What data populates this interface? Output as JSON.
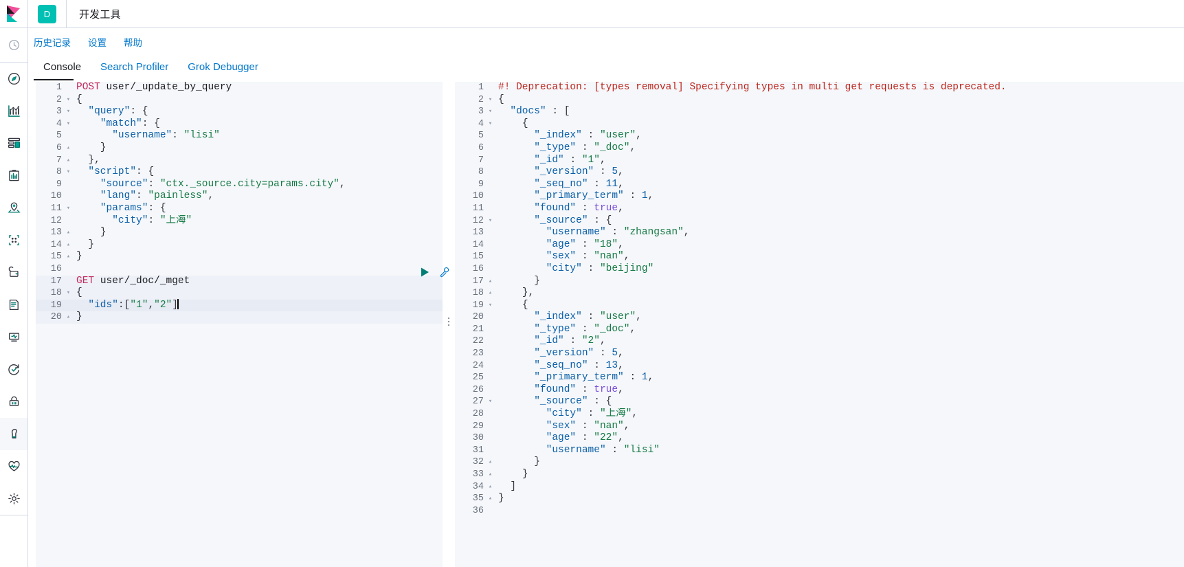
{
  "header": {
    "logo_letter": "D",
    "app_title": "开发工具"
  },
  "rail": {
    "items": [
      {
        "name": "recently-viewed-icon",
        "label": "最近查看"
      },
      {
        "name": "discover-icon",
        "label": "Discover"
      },
      {
        "name": "visualize-icon",
        "label": "Visualize"
      },
      {
        "name": "dashboard-icon",
        "label": "Dashboard"
      },
      {
        "name": "canvas-icon",
        "label": "Canvas"
      },
      {
        "name": "maps-icon",
        "label": "Maps"
      },
      {
        "name": "machine-learning-icon",
        "label": "Machine Learning"
      },
      {
        "name": "infrastructure-icon",
        "label": "Infrastructure"
      },
      {
        "name": "logs-icon",
        "label": "Logs"
      },
      {
        "name": "apm-icon",
        "label": "APM"
      },
      {
        "name": "uptime-icon",
        "label": "Uptime"
      },
      {
        "name": "security-icon",
        "label": "SIEM"
      },
      {
        "name": "dev-tools-icon",
        "label": "开发工具"
      },
      {
        "name": "monitoring-icon",
        "label": "Monitoring"
      },
      {
        "name": "management-icon",
        "label": "Management"
      }
    ],
    "selected_index": 12
  },
  "subnav": {
    "links": [
      {
        "name": "history-link",
        "label": "历史记录"
      },
      {
        "name": "settings-link",
        "label": "设置"
      },
      {
        "name": "help-link",
        "label": "帮助"
      }
    ]
  },
  "tabs": {
    "items": [
      {
        "name": "tab-console",
        "label": "Console",
        "active": true
      },
      {
        "name": "tab-search-profiler",
        "label": "Search Profiler",
        "active": false
      },
      {
        "name": "tab-grok-debugger",
        "label": "Grok Debugger",
        "active": false
      }
    ]
  },
  "request_editor": {
    "title": "request-editor",
    "cursor_line": 19,
    "lines": [
      {
        "n": 1,
        "fold": "",
        "text": "POST user/_update_by_query"
      },
      {
        "n": 2,
        "fold": "▾",
        "text": "{"
      },
      {
        "n": 3,
        "fold": "▾",
        "text": "  \"query\": {"
      },
      {
        "n": 4,
        "fold": "▾",
        "text": "    \"match\": {"
      },
      {
        "n": 5,
        "fold": "",
        "text": "      \"username\": \"lisi\""
      },
      {
        "n": 6,
        "fold": "▴",
        "text": "    }"
      },
      {
        "n": 7,
        "fold": "▴",
        "text": "  },"
      },
      {
        "n": 8,
        "fold": "▾",
        "text": "  \"script\": {"
      },
      {
        "n": 9,
        "fold": "",
        "text": "    \"source\": \"ctx._source.city=params.city\","
      },
      {
        "n": 10,
        "fold": "",
        "text": "    \"lang\": \"painless\","
      },
      {
        "n": 11,
        "fold": "▾",
        "text": "    \"params\": {"
      },
      {
        "n": 12,
        "fold": "",
        "text": "      \"city\": \"上海\""
      },
      {
        "n": 13,
        "fold": "▴",
        "text": "    }"
      },
      {
        "n": 14,
        "fold": "▴",
        "text": "  }"
      },
      {
        "n": 15,
        "fold": "▴",
        "text": "}"
      },
      {
        "n": 16,
        "fold": "",
        "text": ""
      },
      {
        "n": 17,
        "fold": "",
        "text": "GET user/_doc/_mget"
      },
      {
        "n": 18,
        "fold": "▾",
        "text": "{"
      },
      {
        "n": 19,
        "fold": "",
        "text": "  \"ids\":[\"1\",\"2\"]"
      },
      {
        "n": 20,
        "fold": "▴",
        "text": "}"
      }
    ]
  },
  "response_editor": {
    "title": "response-editor",
    "lines": [
      {
        "n": 1,
        "fold": "",
        "text": "#! Deprecation: [types removal] Specifying types in multi get requests is deprecated."
      },
      {
        "n": 2,
        "fold": "▾",
        "text": "{"
      },
      {
        "n": 3,
        "fold": "▾",
        "text": "  \"docs\" : ["
      },
      {
        "n": 4,
        "fold": "▾",
        "text": "    {"
      },
      {
        "n": 5,
        "fold": "",
        "text": "      \"_index\" : \"user\","
      },
      {
        "n": 6,
        "fold": "",
        "text": "      \"_type\" : \"_doc\","
      },
      {
        "n": 7,
        "fold": "",
        "text": "      \"_id\" : \"1\","
      },
      {
        "n": 8,
        "fold": "",
        "text": "      \"_version\" : 5,"
      },
      {
        "n": 9,
        "fold": "",
        "text": "      \"_seq_no\" : 11,"
      },
      {
        "n": 10,
        "fold": "",
        "text": "      \"_primary_term\" : 1,"
      },
      {
        "n": 11,
        "fold": "",
        "text": "      \"found\" : true,"
      },
      {
        "n": 12,
        "fold": "▾",
        "text": "      \"_source\" : {"
      },
      {
        "n": 13,
        "fold": "",
        "text": "        \"username\" : \"zhangsan\","
      },
      {
        "n": 14,
        "fold": "",
        "text": "        \"age\" : \"18\","
      },
      {
        "n": 15,
        "fold": "",
        "text": "        \"sex\" : \"nan\","
      },
      {
        "n": 16,
        "fold": "",
        "text": "        \"city\" : \"beijing\""
      },
      {
        "n": 17,
        "fold": "▴",
        "text": "      }"
      },
      {
        "n": 18,
        "fold": "▴",
        "text": "    },"
      },
      {
        "n": 19,
        "fold": "▾",
        "text": "    {"
      },
      {
        "n": 20,
        "fold": "",
        "text": "      \"_index\" : \"user\","
      },
      {
        "n": 21,
        "fold": "",
        "text": "      \"_type\" : \"_doc\","
      },
      {
        "n": 22,
        "fold": "",
        "text": "      \"_id\" : \"2\","
      },
      {
        "n": 23,
        "fold": "",
        "text": "      \"_version\" : 5,"
      },
      {
        "n": 24,
        "fold": "",
        "text": "      \"_seq_no\" : 13,"
      },
      {
        "n": 25,
        "fold": "",
        "text": "      \"_primary_term\" : 1,"
      },
      {
        "n": 26,
        "fold": "",
        "text": "      \"found\" : true,"
      },
      {
        "n": 27,
        "fold": "▾",
        "text": "      \"_source\" : {"
      },
      {
        "n": 28,
        "fold": "",
        "text": "        \"city\" : \"上海\","
      },
      {
        "n": 29,
        "fold": "",
        "text": "        \"sex\" : \"nan\","
      },
      {
        "n": 30,
        "fold": "",
        "text": "        \"age\" : \"22\","
      },
      {
        "n": 31,
        "fold": "",
        "text": "        \"username\" : \"lisi\""
      },
      {
        "n": 32,
        "fold": "▴",
        "text": "      }"
      },
      {
        "n": 33,
        "fold": "▴",
        "text": "    }"
      },
      {
        "n": 34,
        "fold": "▴",
        "text": "  ]"
      },
      {
        "n": 35,
        "fold": "▴",
        "text": "}"
      },
      {
        "n": 36,
        "fold": "",
        "text": ""
      }
    ]
  },
  "actions": {
    "play_button_label": "Click to send request",
    "wrench_button_label": "Open documentation / auto indent"
  },
  "colors": {
    "brand_teal": "#00bfb3",
    "link_blue": "#0077cc",
    "method": "#c5285b",
    "string": "#157a45",
    "key": "#0a5fa8",
    "boolean": "#7a4ddb",
    "warning_red": "#bd271e",
    "editor_bg": "#f5f7fa",
    "highlight_bg": "#e7ebf3",
    "border": "#d3dae6"
  }
}
